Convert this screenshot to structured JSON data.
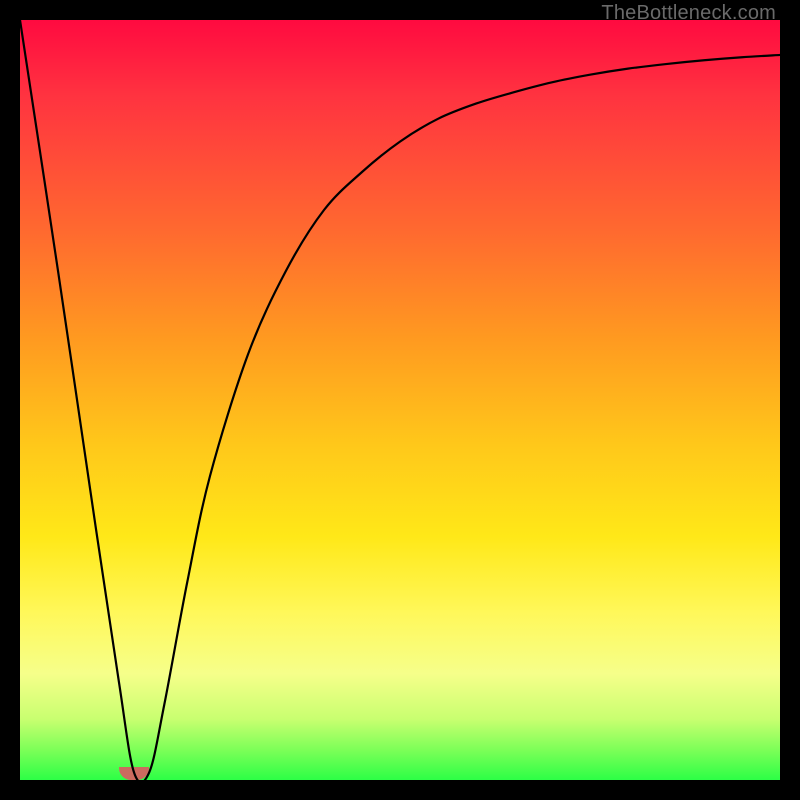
{
  "watermark": "TheBottleneck.com",
  "colors": {
    "frame": "#000000",
    "curve": "#000000",
    "marker": "#cc6b5f",
    "watermark_text": "#6a6a6a"
  },
  "chart_data": {
    "type": "line",
    "title": "",
    "xlabel": "",
    "ylabel": "",
    "xlim": [
      0,
      100
    ],
    "ylim": [
      0,
      100
    ],
    "series": [
      {
        "name": "bottleneck-curve",
        "x": [
          0,
          5,
          10,
          13,
          15,
          17,
          19,
          22,
          25,
          30,
          35,
          40,
          45,
          50,
          55,
          60,
          65,
          70,
          75,
          80,
          85,
          90,
          95,
          100
        ],
        "y": [
          100,
          67,
          33,
          13,
          1,
          1,
          10,
          26,
          40,
          56,
          67,
          75,
          80,
          84,
          87,
          89,
          90.5,
          91.8,
          92.8,
          93.6,
          94.2,
          94.7,
          95.1,
          95.4
        ]
      }
    ],
    "marker": {
      "x_start": 13,
      "x_end": 17,
      "height_pct": 1.7
    },
    "annotations": [
      {
        "text": "TheBottleneck.com",
        "pos": "top-right"
      }
    ]
  }
}
